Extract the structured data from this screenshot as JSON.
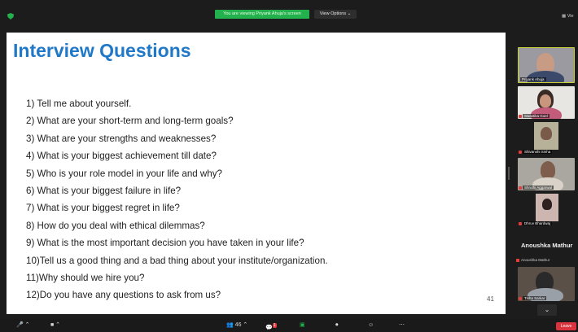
{
  "meeting": {
    "share_banner": "You are viewing Priyank Ahuja's screen",
    "view_options_label": "View Options ⌄",
    "view_label": "Vie"
  },
  "slide": {
    "title": "Interview Questions",
    "questions": [
      "1) Tell me about yourself.",
      "2) What are your short-term and long-term goals?",
      "3) What are your strengths and weaknesses?",
      "4) What is your biggest achievement till date?",
      "5) Who is your role model in your life and why?",
      "6) What is your biggest failure in life?",
      "7) What is your biggest regret in life?",
      "8) How do you deal with ethical dilemmas?",
      "9) What is the most important decision you have taken in your life?",
      "10)Tell us a good thing and a bad thing about your institute/organization.",
      "11)Why should we hire you?",
      "12)Do you have any questions to ask from us?"
    ],
    "page_number": "41"
  },
  "participants": [
    {
      "name": "Priyank Ahuja",
      "muted": false,
      "active": true
    },
    {
      "name": "Swastika Goel",
      "muted": true,
      "active": false
    },
    {
      "name": "Shivanshi Sinha",
      "muted": true,
      "active": false
    },
    {
      "name": "Shruthi Aggarwal",
      "muted": true,
      "active": false
    },
    {
      "name": "Dhruv Bhardwaj",
      "muted": true,
      "active": false
    },
    {
      "name": "Anoushka Mathur",
      "muted": true,
      "active": false
    },
    {
      "name": "Tisha Sarkar",
      "muted": true,
      "active": false
    }
  ],
  "toolbar": {
    "participants_count": "46",
    "chat_badge": "1",
    "leave_label": "Leave"
  },
  "colors": {
    "title_blue": "#1f78c8",
    "share_green": "#22b14c",
    "leave_red": "#d9333f",
    "active_border": "#c9d23a"
  }
}
